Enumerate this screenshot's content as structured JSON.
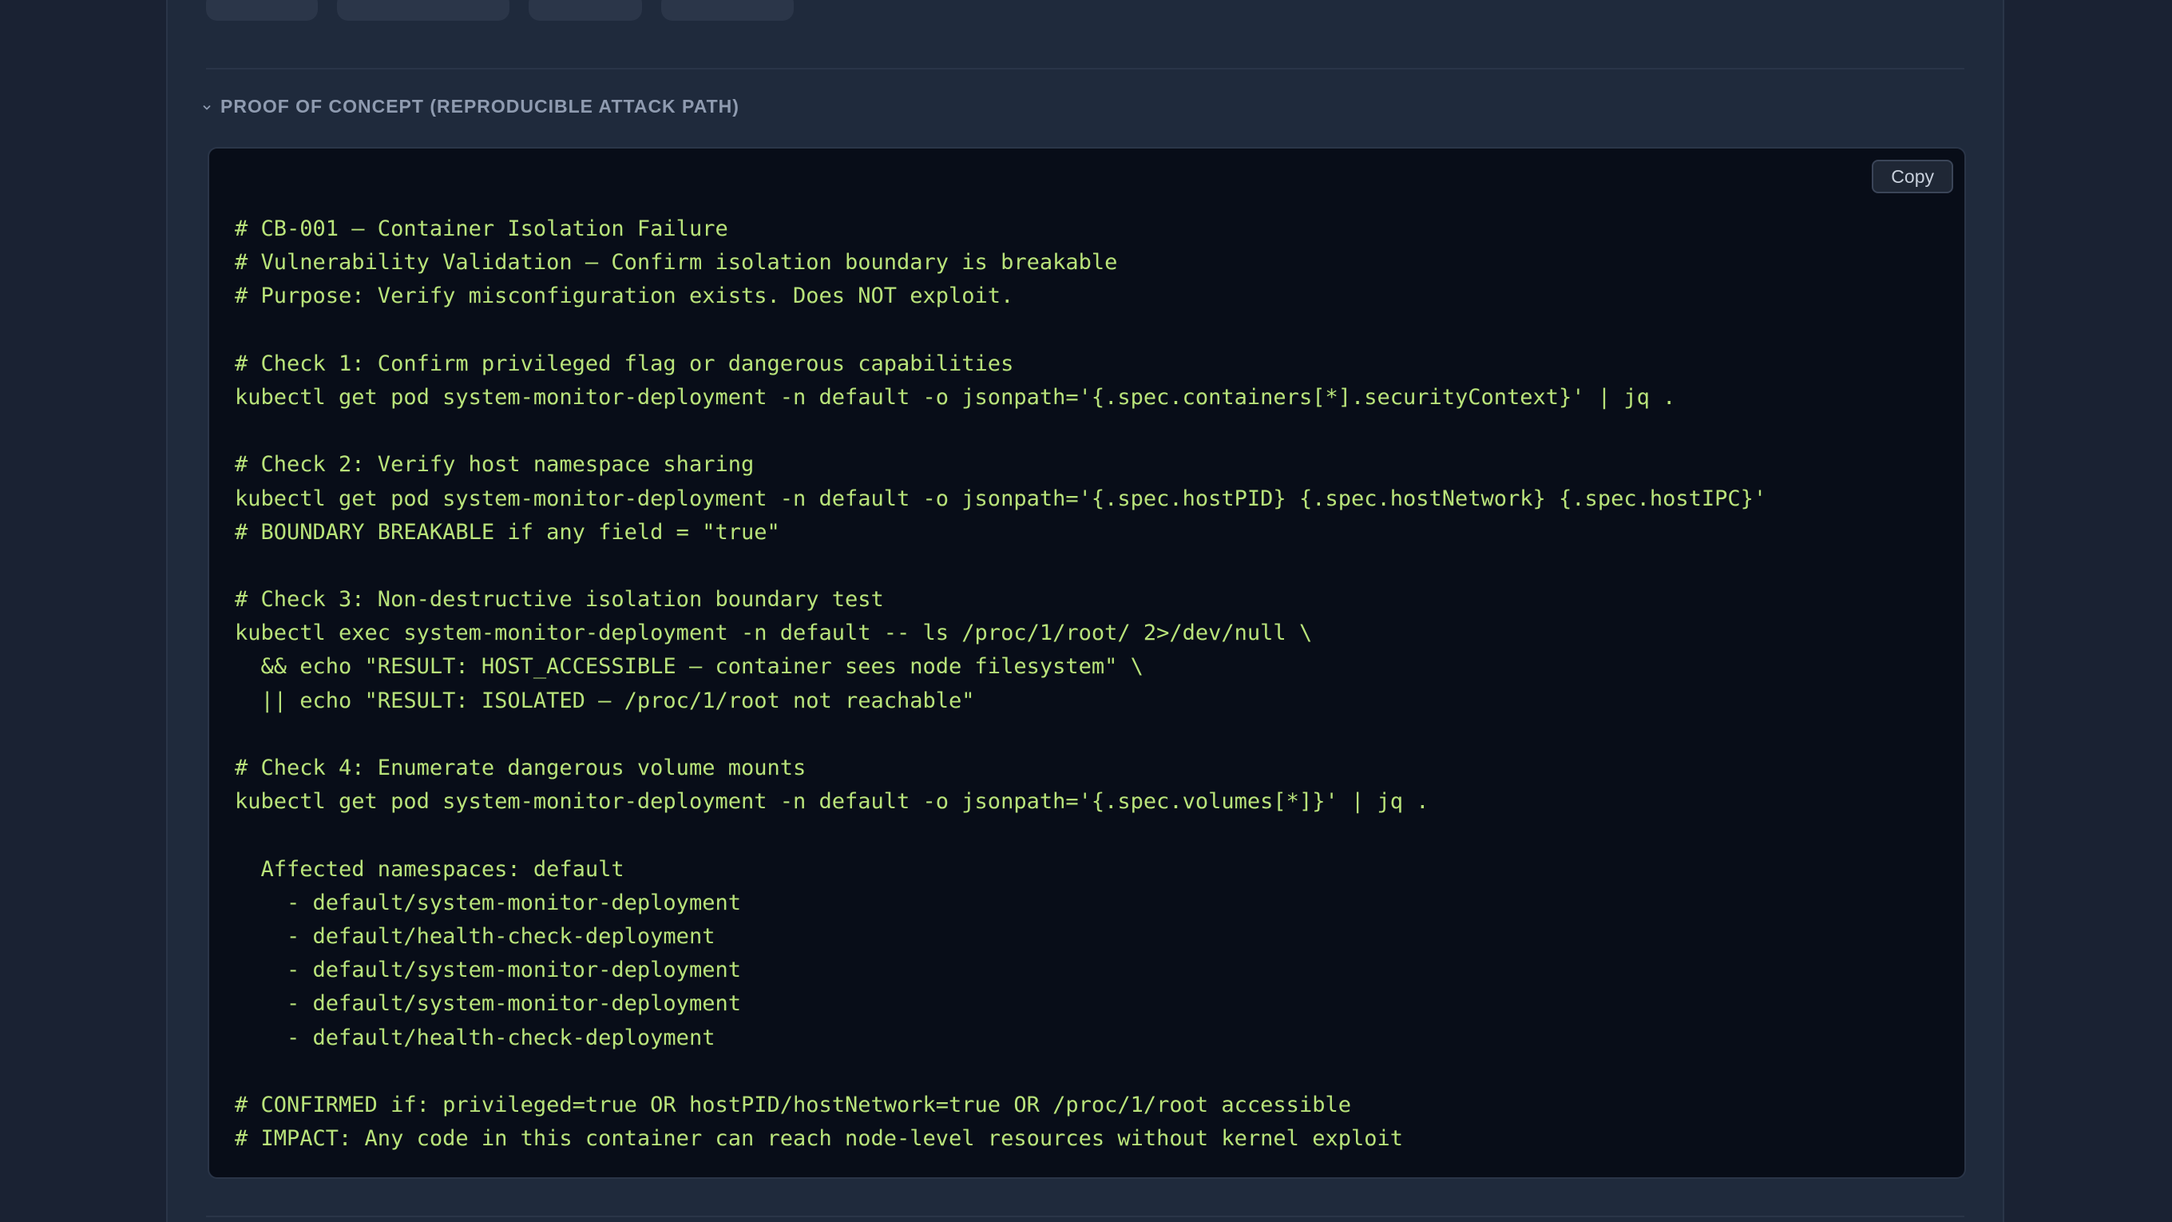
{
  "section": {
    "title": "PROOF OF CONCEPT (REPRODUCIBLE ATTACK PATH)",
    "chevron_icon": "chevron-down-icon",
    "expanded": true
  },
  "code_block": {
    "copy_label": "Copy",
    "lines": [
      "# CB-001 — Container Isolation Failure",
      "# Vulnerability Validation — Confirm isolation boundary is breakable",
      "# Purpose: Verify misconfiguration exists. Does NOT exploit.",
      "",
      "# Check 1: Confirm privileged flag or dangerous capabilities",
      "kubectl get pod system-monitor-deployment -n default -o jsonpath='{.spec.containers[*].securityContext}' | jq .",
      "",
      "# Check 2: Verify host namespace sharing",
      "kubectl get pod system-monitor-deployment -n default -o jsonpath='{.spec.hostPID} {.spec.hostNetwork} {.spec.hostIPC}'",
      "# BOUNDARY BREAKABLE if any field = \"true\"",
      "",
      "# Check 3: Non-destructive isolation boundary test",
      "kubectl exec system-monitor-deployment -n default -- ls /proc/1/root/ 2>/dev/null \\",
      "  && echo \"RESULT: HOST_ACCESSIBLE — container sees node filesystem\" \\",
      "  || echo \"RESULT: ISOLATED — /proc/1/root not reachable\"",
      "",
      "# Check 4: Enumerate dangerous volume mounts",
      "kubectl get pod system-monitor-deployment -n default -o jsonpath='{.spec.volumes[*]}' | jq .",
      "",
      "  Affected namespaces: default",
      "    - default/system-monitor-deployment",
      "    - default/health-check-deployment",
      "    - default/system-monitor-deployment",
      "    - default/system-monitor-deployment",
      "    - default/health-check-deployment",
      "",
      "# CONFIRMED if: privileged=true OR hostPID/hostNetwork=true OR /proc/1/root accessible",
      "# IMPACT: Any code in this container can reach node-level resources without kernel exploit"
    ]
  },
  "colors": {
    "page_bg": "#1a2233",
    "panel_bg": "#1f2a3c",
    "code_bg": "#080d18",
    "code_text": "#b9e37a",
    "header_text": "#8f9bb0"
  }
}
